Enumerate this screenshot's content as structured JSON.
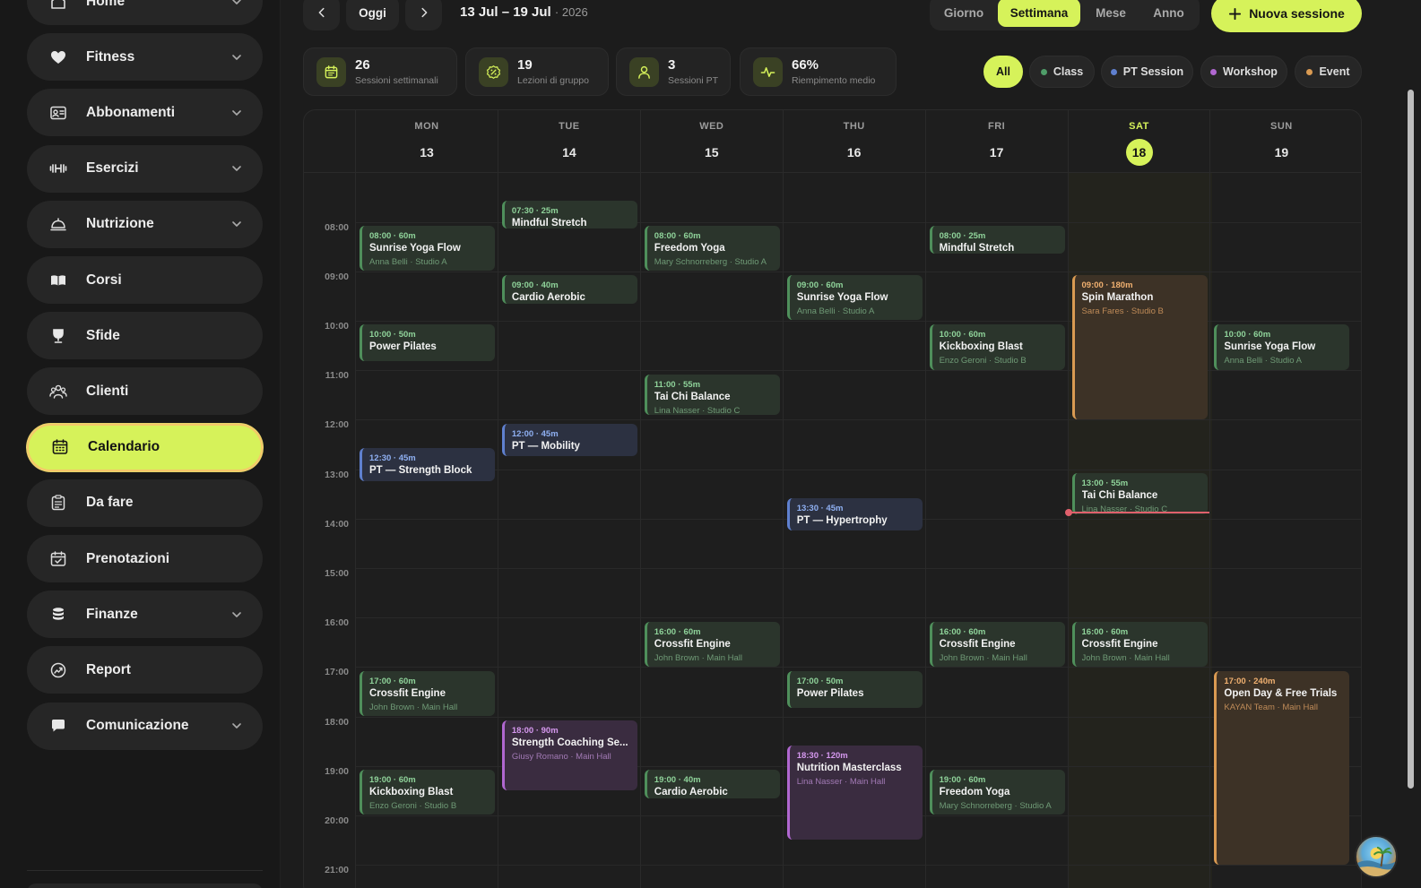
{
  "sidebar": {
    "items": [
      {
        "label": "Home",
        "icon": "home-icon"
      },
      {
        "label": "Fitness",
        "icon": "heart-icon"
      },
      {
        "label": "Abbonamenti",
        "icon": "id-card-icon"
      },
      {
        "label": "Esercizi",
        "icon": "dumbbell-icon"
      },
      {
        "label": "Nutrizione",
        "icon": "cloche-icon"
      },
      {
        "label": "Corsi",
        "icon": "book-icon"
      },
      {
        "label": "Sfide",
        "icon": "trophy-icon"
      },
      {
        "label": "Clienti",
        "icon": "users-icon"
      },
      {
        "label": "Calendario",
        "icon": "calendar-icon"
      },
      {
        "label": "Da fare",
        "icon": "clipboard-icon"
      },
      {
        "label": "Prenotazioni",
        "icon": "calendar-check-icon"
      },
      {
        "label": "Finanze",
        "icon": "coins-icon"
      },
      {
        "label": "Report",
        "icon": "chart-icon"
      },
      {
        "label": "Comunicazione",
        "icon": "chat-icon"
      }
    ],
    "active": "Calendario"
  },
  "toolbar": {
    "today_label": "Oggi",
    "date_range": "13 Jul – 19 Jul",
    "year": "· 2026",
    "views": [
      "Giorno",
      "Settimana",
      "Mese",
      "Anno"
    ],
    "active_view": "Settimana",
    "new_session_label": "Nuova sessione"
  },
  "stats": [
    {
      "value": "26",
      "label": "Sessioni settimanali",
      "icon": "calendar-icon"
    },
    {
      "value": "19",
      "label": "Lezioni di gruppo",
      "icon": "percent-badge-icon"
    },
    {
      "value": "3",
      "label": "Sessioni PT",
      "icon": "user-icon"
    },
    {
      "value": "66%",
      "label": "Riempimento medio",
      "icon": "pulse-icon"
    }
  ],
  "filters": [
    {
      "label": "All",
      "color": null,
      "active": true
    },
    {
      "label": "Class",
      "color": "#4f9d69",
      "active": false
    },
    {
      "label": "PT Session",
      "color": "#5f80cf",
      "active": false
    },
    {
      "label": "Workshop",
      "color": "#b067d0",
      "active": false
    },
    {
      "label": "Event",
      "color": "#d99a52",
      "active": false
    }
  ],
  "calendar": {
    "days": [
      {
        "name": "MON",
        "num": "13"
      },
      {
        "name": "TUE",
        "num": "14"
      },
      {
        "name": "WED",
        "num": "15"
      },
      {
        "name": "THU",
        "num": "16"
      },
      {
        "name": "FRI",
        "num": "17"
      },
      {
        "name": "SAT",
        "num": "18",
        "today": true
      },
      {
        "name": "SUN",
        "num": "19"
      }
    ],
    "hours": [
      "08:00",
      "09:00",
      "10:00",
      "11:00",
      "12:00",
      "13:00",
      "14:00",
      "15:00",
      "16:00",
      "17:00",
      "18:00",
      "19:00",
      "20:00",
      "21:00"
    ],
    "now": {
      "day": 5,
      "time": "13:47"
    },
    "events": [
      {
        "day": 0,
        "start": "08:00",
        "mins": 60,
        "time": "08:00 · 60m",
        "name": "Sunrise Yoga Flow",
        "sub": "Anna Belli · Studio A",
        "type": "class"
      },
      {
        "day": 0,
        "start": "10:00",
        "mins": 50,
        "time": "10:00 · 50m",
        "name": "Power Pilates",
        "sub": "",
        "type": "class"
      },
      {
        "day": 0,
        "start": "12:30",
        "mins": 45,
        "time": "12:30 · 45m",
        "name": "PT — Strength Block",
        "sub": "",
        "type": "pt"
      },
      {
        "day": 0,
        "start": "17:00",
        "mins": 60,
        "time": "17:00 · 60m",
        "name": "Crossfit Engine",
        "sub": "John Brown · Main Hall",
        "type": "class"
      },
      {
        "day": 0,
        "start": "19:00",
        "mins": 60,
        "time": "19:00 · 60m",
        "name": "Kickboxing Blast",
        "sub": "Enzo Geroni · Studio B",
        "type": "class"
      },
      {
        "day": 1,
        "start": "07:30",
        "mins": 25,
        "time": "07:30 · 25m",
        "name": "Mindful Stretch",
        "sub": "",
        "type": "class"
      },
      {
        "day": 1,
        "start": "09:00",
        "mins": 40,
        "time": "09:00 · 40m",
        "name": "Cardio Aerobic",
        "sub": "",
        "type": "class"
      },
      {
        "day": 1,
        "start": "12:00",
        "mins": 45,
        "time": "12:00 · 45m",
        "name": "PT — Mobility",
        "sub": "",
        "type": "pt"
      },
      {
        "day": 1,
        "start": "18:00",
        "mins": 90,
        "time": "18:00 · 90m",
        "name": "Strength Coaching Se...",
        "sub": "Giusy Romano · Main Hall",
        "type": "workshop"
      },
      {
        "day": 2,
        "start": "08:00",
        "mins": 60,
        "time": "08:00 · 60m",
        "name": "Freedom Yoga",
        "sub": "Mary Schnorreberg · Studio A",
        "type": "class"
      },
      {
        "day": 2,
        "start": "11:00",
        "mins": 55,
        "time": "11:00 · 55m",
        "name": "Tai Chi Balance",
        "sub": "Lina Nasser · Studio C",
        "type": "class"
      },
      {
        "day": 2,
        "start": "16:00",
        "mins": 60,
        "time": "16:00 · 60m",
        "name": "Crossfit Engine",
        "sub": "John Brown · Main Hall",
        "type": "class"
      },
      {
        "day": 2,
        "start": "19:00",
        "mins": 40,
        "time": "19:00 · 40m",
        "name": "Cardio Aerobic",
        "sub": "",
        "type": "class"
      },
      {
        "day": 3,
        "start": "09:00",
        "mins": 60,
        "time": "09:00 · 60m",
        "name": "Sunrise Yoga Flow",
        "sub": "Anna Belli · Studio A",
        "type": "class"
      },
      {
        "day": 3,
        "start": "13:30",
        "mins": 45,
        "time": "13:30 · 45m",
        "name": "PT — Hypertrophy",
        "sub": "",
        "type": "pt"
      },
      {
        "day": 3,
        "start": "17:00",
        "mins": 50,
        "time": "17:00 · 50m",
        "name": "Power Pilates",
        "sub": "",
        "type": "class"
      },
      {
        "day": 3,
        "start": "18:30",
        "mins": 120,
        "time": "18:30 · 120m",
        "name": "Nutrition Masterclass",
        "sub": "Lina Nasser · Main Hall",
        "type": "workshop"
      },
      {
        "day": 4,
        "start": "08:00",
        "mins": 25,
        "time": "08:00 · 25m",
        "name": "Mindful Stretch",
        "sub": "",
        "type": "class"
      },
      {
        "day": 4,
        "start": "10:00",
        "mins": 60,
        "time": "10:00 · 60m",
        "name": "Kickboxing Blast",
        "sub": "Enzo Geroni · Studio B",
        "type": "class"
      },
      {
        "day": 4,
        "start": "16:00",
        "mins": 60,
        "time": "16:00 · 60m",
        "name": "Crossfit Engine",
        "sub": "John Brown · Main Hall",
        "type": "class"
      },
      {
        "day": 4,
        "start": "19:00",
        "mins": 60,
        "time": "19:00 · 60m",
        "name": "Freedom Yoga",
        "sub": "Mary Schnorreberg · Studio A",
        "type": "class"
      },
      {
        "day": 5,
        "start": "09:00",
        "mins": 180,
        "time": "09:00 · 180m",
        "name": "Spin Marathon",
        "sub": "Sara Fares · Studio B",
        "type": "event"
      },
      {
        "day": 5,
        "start": "13:00",
        "mins": 55,
        "time": "13:00 · 55m",
        "name": "Tai Chi Balance",
        "sub": "Lina Nasser · Studio C",
        "type": "class"
      },
      {
        "day": 5,
        "start": "16:00",
        "mins": 60,
        "time": "16:00 · 60m",
        "name": "Crossfit Engine",
        "sub": "John Brown · Main Hall",
        "type": "class"
      },
      {
        "day": 6,
        "start": "10:00",
        "mins": 60,
        "time": "10:00 · 60m",
        "name": "Sunrise Yoga Flow",
        "sub": "Anna Belli · Studio A",
        "type": "class"
      },
      {
        "day": 6,
        "start": "17:00",
        "mins": 240,
        "time": "17:00 · 240m",
        "name": "Open Day & Free Trials",
        "sub": "KAYAN Team · Main Hall",
        "type": "event"
      }
    ]
  }
}
